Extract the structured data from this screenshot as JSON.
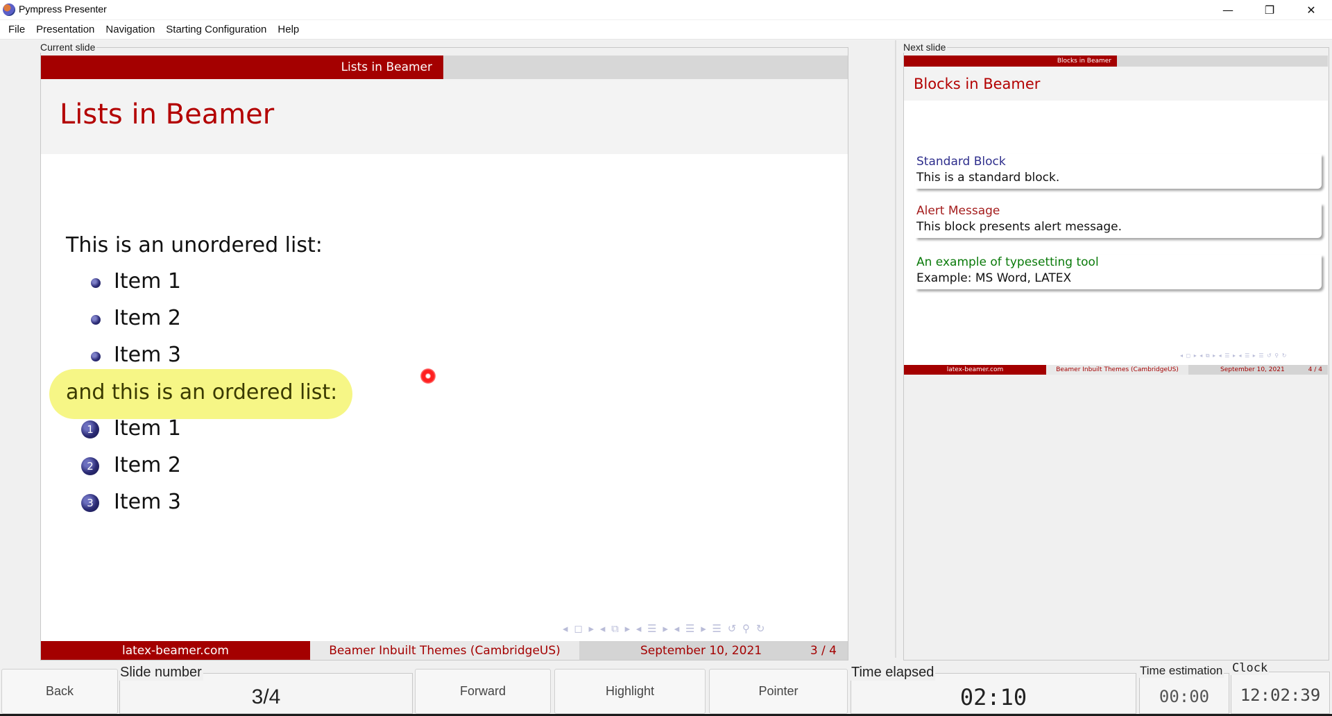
{
  "window": {
    "title": "Pympress Presenter",
    "minimize": "—",
    "maximize": "❐",
    "close": "✕"
  },
  "menu": [
    "File",
    "Presentation",
    "Navigation",
    "Starting Configuration",
    "Help"
  ],
  "current": {
    "label": "Current slide",
    "headline": "Lists in Beamer",
    "title": "Lists in Beamer",
    "intro_unordered": "This is an unordered list:",
    "unordered": [
      "Item 1",
      "Item 2",
      "Item 3"
    ],
    "intro_ordered": "and this is an ordered list:",
    "ordered": [
      {
        "num": "1",
        "text": "Item 1"
      },
      {
        "num": "2",
        "text": "Item 2"
      },
      {
        "num": "3",
        "text": "Item 3"
      }
    ],
    "footer": {
      "site": "latex-beamer.com",
      "theme": "Beamer Inbuilt Themes (CambridgeUS)",
      "date": "September 10, 2021",
      "page": "3 / 4"
    },
    "nav_symbols": "◂ ◻ ▸  ◂ ⧉ ▸  ◂ ☰ ▸  ◂ ☰ ▸    ☰    ↺ ⚲ ↻"
  },
  "next": {
    "label": "Next slide",
    "headline": "Blocks in Beamer",
    "title": "Blocks in Beamer",
    "blocks": [
      {
        "title": "Standard Block",
        "body": "This is a standard block.",
        "color": "#2e2e8c"
      },
      {
        "title": "Alert Message",
        "body": "This block presents alert message.",
        "color": "#a41c1c"
      },
      {
        "title": "An example of typesetting tool",
        "body": "Example:  MS Word, LATEX",
        "color": "#0a7a0a"
      }
    ],
    "footer": {
      "site": "latex-beamer.com",
      "theme": "Beamer Inbuilt Themes (CambridgeUS)",
      "date": "September 10, 2021",
      "page": "4 / 4"
    },
    "nav_symbols": "◂ ◻ ▸ ◂ ⧉ ▸ ◂ ☰ ▸ ◂ ☰ ▸  ☰  ↺ ⚲ ↻"
  },
  "toolbar": {
    "back": "Back",
    "slide_number_label": "Slide number",
    "slide_number_value": "3/4",
    "forward": "Forward",
    "highlight": "Highlight",
    "pointer": "Pointer",
    "time_elapsed_label": "Time elapsed",
    "time_elapsed_value": "02:10",
    "time_estimation_label": "Time estimation",
    "time_estimation_value": "00:00",
    "clock_label": "Clock",
    "clock_value": "12:02:39"
  },
  "colors": {
    "beamer_red": "#a40000",
    "title_red": "#b30000",
    "highlight_yellow": "#f0f03c",
    "pointer_red": "#ff2020"
  }
}
